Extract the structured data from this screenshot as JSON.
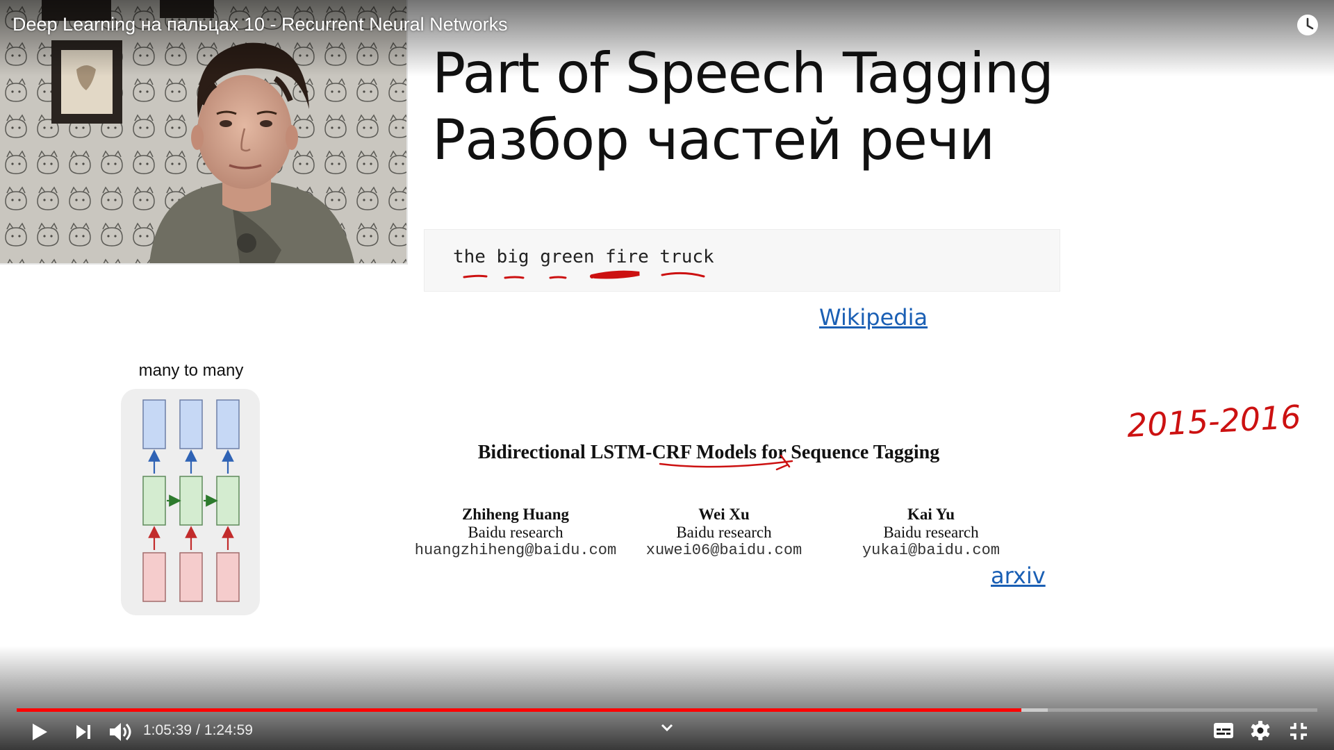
{
  "player": {
    "video_title": "Deep Learning на пальцах 10 - Recurrent Neural Networks",
    "current_time": "1:05:39",
    "separator": "/",
    "duration": "1:24:59",
    "progress_fraction": 0.7726,
    "buffered_fraction": 0.7926,
    "accent_color": "#ff0000",
    "controls": {
      "play": "play-icon",
      "next": "next-icon",
      "volume": "volume-icon",
      "chapters": "chevron-down-icon",
      "subtitles": "subtitles-icon",
      "settings": "gear-icon",
      "exit_fullscreen": "exit-fullscreen-icon",
      "watch_later": "clock-icon"
    }
  },
  "slide": {
    "title_line1": "Part of Speech Tagging",
    "title_line2": "Разбор частей речи",
    "code_example": "the big green fire truck",
    "wikipedia_link": "Wikipedia",
    "diagram_label": "many to many",
    "annotation_years": "2015-2016",
    "link_color": "#1a5fb4",
    "ink_color": "#cc1111",
    "paper": {
      "title": "Bidirectional LSTM-CRF Models for Sequence Tagging",
      "authors": [
        {
          "name": "Zhiheng Huang",
          "affiliation": "Baidu research",
          "email": "huangzhiheng@baidu.com"
        },
        {
          "name": "Wei Xu",
          "affiliation": "Baidu research",
          "email": "xuwei06@baidu.com"
        },
        {
          "name": "Kai Yu",
          "affiliation": "Baidu research",
          "email": "yukai@baidu.com"
        }
      ],
      "arxiv_link": "arxiv"
    }
  }
}
